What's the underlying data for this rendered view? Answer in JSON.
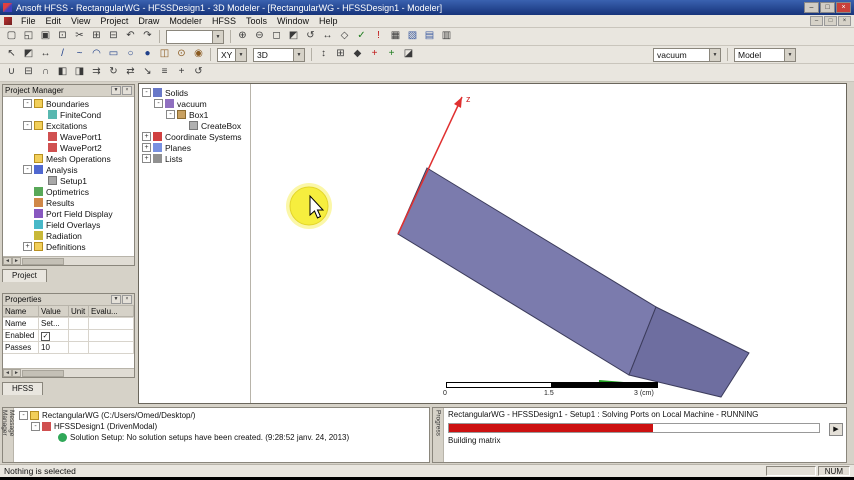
{
  "colors": {
    "titlebar_blue": "#16337a",
    "box_fill": "#7b7bad",
    "box_end_fill": "#6e6ea0",
    "highlight_yellow": "#f6ee3e",
    "axis_red": "#dd2222",
    "axis_green": "#1f9e1f",
    "progress_red": "#cc1111"
  },
  "ui": {
    "dropdown": "▼",
    "close": "×",
    "left": "◄",
    "right": "►"
  },
  "window": {
    "title": "Ansoft HFSS - RectangularWG - HFSSDesign1 - 3D Modeler - [RectangularWG - HFSSDesign1 - Modeler]",
    "minimize": "–",
    "maximize": "□",
    "close": "×"
  },
  "menubar": {
    "items": [
      "File",
      "Edit",
      "View",
      "Project",
      "Draw",
      "Modeler",
      "HFSS",
      "Tools",
      "Window",
      "Help"
    ],
    "child_min": "–",
    "child_restore": "□",
    "child_close": "×"
  },
  "toolbars": {
    "row1": [
      {
        "n": "new-file",
        "g": "▢"
      },
      {
        "n": "open-file",
        "g": "◱"
      },
      {
        "n": "save",
        "g": "▣"
      },
      {
        "n": "print",
        "g": "⊡"
      },
      {
        "n": "cut",
        "g": "✂"
      },
      {
        "n": "copy",
        "g": "⊞"
      },
      {
        "n": "paste",
        "g": "⊟"
      },
      {
        "n": "undo",
        "g": "↶"
      },
      {
        "n": "redo",
        "g": "↷"
      }
    ],
    "sim_combo_value": "",
    "row1b": [
      {
        "n": "zoom-in",
        "g": "⊕"
      },
      {
        "n": "zoom-out",
        "g": "⊖"
      },
      {
        "n": "fit-all",
        "g": "◻"
      },
      {
        "n": "fit-selection",
        "g": "◩"
      },
      {
        "n": "rotate-view",
        "g": "↺"
      },
      {
        "n": "pan-view",
        "g": "↔"
      },
      {
        "n": "orient-view",
        "g": "◇"
      },
      {
        "n": "validate",
        "g": "✓",
        "c": "#1e7d1e"
      },
      {
        "n": "analyze-all",
        "g": "!",
        "c": "#c01818"
      },
      {
        "n": "matrix-data",
        "g": "▦"
      },
      {
        "n": "field-plot",
        "g": "▧",
        "c": "#3a5aa0"
      },
      {
        "n": "remote-analysis",
        "g": "▤",
        "c": "#3a5aa0"
      },
      {
        "n": "job-monitor",
        "g": "▥"
      }
    ],
    "row2a": [
      {
        "n": "select-object",
        "g": "↖"
      },
      {
        "n": "select-face",
        "g": "◩"
      },
      {
        "n": "move-mode",
        "g": "↔"
      },
      {
        "n": "draw-line",
        "g": "/",
        "c": "#20408a"
      },
      {
        "n": "draw-spline",
        "g": "~",
        "c": "#20408a"
      },
      {
        "n": "draw-arc",
        "g": "◠",
        "c": "#20408a"
      },
      {
        "n": "draw-rectangle",
        "g": "▭",
        "c": "#20408a"
      },
      {
        "n": "draw-ellipse",
        "g": "○",
        "c": "#20408a"
      },
      {
        "n": "draw-circle",
        "g": "●",
        "c": "#20408a"
      },
      {
        "n": "draw-box",
        "g": "◫",
        "c": "#8a5a20"
      },
      {
        "n": "draw-cylinder",
        "g": "⊙",
        "c": "#8a5a20"
      },
      {
        "n": "draw-sphere",
        "g": "◉",
        "c": "#8a5a20"
      }
    ],
    "plane_combo_value": "XY",
    "view_combo_value": "3D",
    "row2b": [
      {
        "n": "measure",
        "g": "↕"
      },
      {
        "n": "grid-settings",
        "g": "⊞"
      },
      {
        "n": "snap-mode",
        "g": "◆"
      },
      {
        "n": "local-cs",
        "g": "+",
        "c": "#c01818"
      },
      {
        "n": "relative-cs",
        "g": "+",
        "c": "#1e7d1e"
      },
      {
        "n": "face-cs",
        "g": "◪"
      }
    ],
    "material_combo_value": "vacuum",
    "model_combo_value": "Model",
    "row3": [
      {
        "n": "boolean-unite",
        "g": "∪"
      },
      {
        "n": "boolean-subtract",
        "g": "⊟"
      },
      {
        "n": "boolean-intersect",
        "g": "∩"
      },
      {
        "n": "split",
        "g": "◧"
      },
      {
        "n": "section",
        "g": "◨"
      },
      {
        "n": "duplicate-along-line",
        "g": "⇉"
      },
      {
        "n": "duplicate-around-axis",
        "g": "↻"
      },
      {
        "n": "duplicate-mirror",
        "g": "⇄"
      },
      {
        "n": "scale",
        "g": "↘"
      },
      {
        "n": "align",
        "g": "≡"
      },
      {
        "n": "move",
        "g": "+"
      },
      {
        "n": "rotate",
        "g": "↺"
      }
    ]
  },
  "project_manager": {
    "title": "Project Manager",
    "tab": "Project",
    "tree": [
      {
        "e": "-",
        "label": "Boundaries"
      },
      {
        "e": "",
        "label": "FiniteCond"
      },
      {
        "e": "-",
        "label": "Excitations"
      },
      {
        "e": "",
        "label": "WavePort1"
      },
      {
        "e": "",
        "label": "WavePort2"
      },
      {
        "e": "",
        "label": "Mesh Operations"
      },
      {
        "e": "-",
        "label": "Analysis"
      },
      {
        "e": "",
        "label": "Setup1"
      },
      {
        "e": "",
        "label": "Optimetrics"
      },
      {
        "e": "",
        "label": "Results"
      },
      {
        "e": "",
        "label": "Port Field Display"
      },
      {
        "e": "",
        "label": "Field Overlays"
      },
      {
        "e": "",
        "label": "Radiation"
      },
      {
        "e": "+",
        "label": "Definitions"
      }
    ]
  },
  "properties": {
    "title": "Properties",
    "tab": "HFSS",
    "headers": [
      "Name",
      "Value",
      "Unit",
      "Evalu..."
    ],
    "rows": [
      {
        "name": "Name",
        "value": "Set...",
        "unit": "",
        "eval": ""
      },
      {
        "name": "Enabled",
        "value": "✓",
        "unit": "",
        "eval": ""
      },
      {
        "name": "Passes",
        "value": "10",
        "unit": "",
        "eval": ""
      }
    ]
  },
  "model_tree": [
    {
      "e": "-",
      "label": "Solids"
    },
    {
      "e": "-",
      "label": "vacuum"
    },
    {
      "e": "-",
      "label": "Box1"
    },
    {
      "e": "",
      "label": "CreateBox"
    },
    {
      "e": "+",
      "label": "Coordinate Systems"
    },
    {
      "e": "+",
      "label": "Planes"
    },
    {
      "e": "+",
      "label": "Lists"
    }
  ],
  "viewport": {
    "axis_label": "z",
    "scale": {
      "t0": "0",
      "t1": "1.5",
      "t2": "3 (cm)"
    }
  },
  "messages": {
    "dock_label": "Message Manager",
    "rows": [
      {
        "e": "-",
        "label": "RectangularWG (C:/Users/Omed/Desktop/)"
      },
      {
        "e": "-",
        "label": "HFSSDesign1 (DrivenModal)"
      },
      {
        "e": "",
        "label": "Solution Setup: No solution setups have been created. (9:28:52 janv. 24, 2013)"
      }
    ]
  },
  "progress": {
    "dock_label": "Progress",
    "header": "RectangularWG - HFSSDesign1 - Setup1 : Solving Ports on Local Machine - RUNNING",
    "detail": "Building matrix",
    "percent": 55,
    "bar_style": "width:55%",
    "expand_button": "▶"
  },
  "statusbar": {
    "left": "Nothing is selected",
    "num": "NUM"
  }
}
